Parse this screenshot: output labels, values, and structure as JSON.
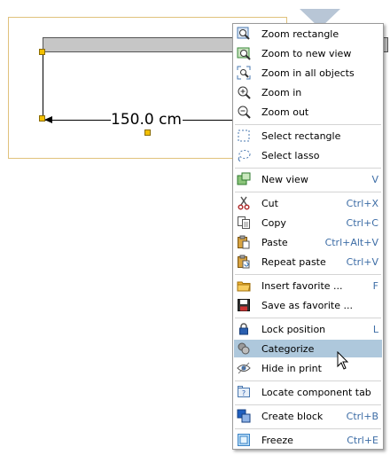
{
  "drawing": {
    "dimension_text": "150.0 cm"
  },
  "menu": {
    "groups": [
      [
        {
          "label": "Zoom rectangle",
          "shortcut": "",
          "icon": "zoom-rectangle-icon"
        },
        {
          "label": "Zoom to new view",
          "shortcut": "",
          "icon": "zoom-new-view-icon"
        },
        {
          "label": "Zoom in all objects",
          "shortcut": "",
          "icon": "zoom-all-icon"
        },
        {
          "label": "Zoom in",
          "shortcut": "",
          "icon": "zoom-in-icon"
        },
        {
          "label": "Zoom out",
          "shortcut": "",
          "icon": "zoom-out-icon"
        }
      ],
      [
        {
          "label": "Select rectangle",
          "shortcut": "",
          "icon": "select-rectangle-icon"
        },
        {
          "label": "Select lasso",
          "shortcut": "",
          "icon": "select-lasso-icon"
        }
      ],
      [
        {
          "label": "New view",
          "shortcut": "V",
          "icon": "new-view-icon"
        }
      ],
      [
        {
          "label": "Cut",
          "shortcut": "Ctrl+X",
          "icon": "scissors-icon"
        },
        {
          "label": "Copy",
          "shortcut": "Ctrl+C",
          "icon": "copy-icon"
        },
        {
          "label": "Paste",
          "shortcut": "Ctrl+Alt+V",
          "icon": "paste-icon"
        },
        {
          "label": "Repeat paste",
          "shortcut": "Ctrl+V",
          "icon": "repeat-paste-icon"
        }
      ],
      [
        {
          "label": "Insert favorite ...",
          "shortcut": "F",
          "icon": "folder-icon"
        },
        {
          "label": "Save as favorite ...",
          "shortcut": "",
          "icon": "floppy-disk-icon"
        }
      ],
      [
        {
          "label": "Lock position",
          "shortcut": "L",
          "icon": "lock-icon"
        },
        {
          "label": "Categorize",
          "shortcut": "",
          "icon": "categorize-icon",
          "highlighted": true
        },
        {
          "label": "Hide in print",
          "shortcut": "",
          "icon": "hide-eye-icon"
        }
      ],
      [
        {
          "label": "Locate component tab",
          "shortcut": "",
          "icon": "locate-tab-icon"
        }
      ],
      [
        {
          "label": "Create block",
          "shortcut": "Ctrl+B",
          "icon": "create-block-icon"
        }
      ],
      [
        {
          "label": "Freeze",
          "shortcut": "Ctrl+E",
          "icon": "freeze-icon"
        }
      ]
    ]
  }
}
